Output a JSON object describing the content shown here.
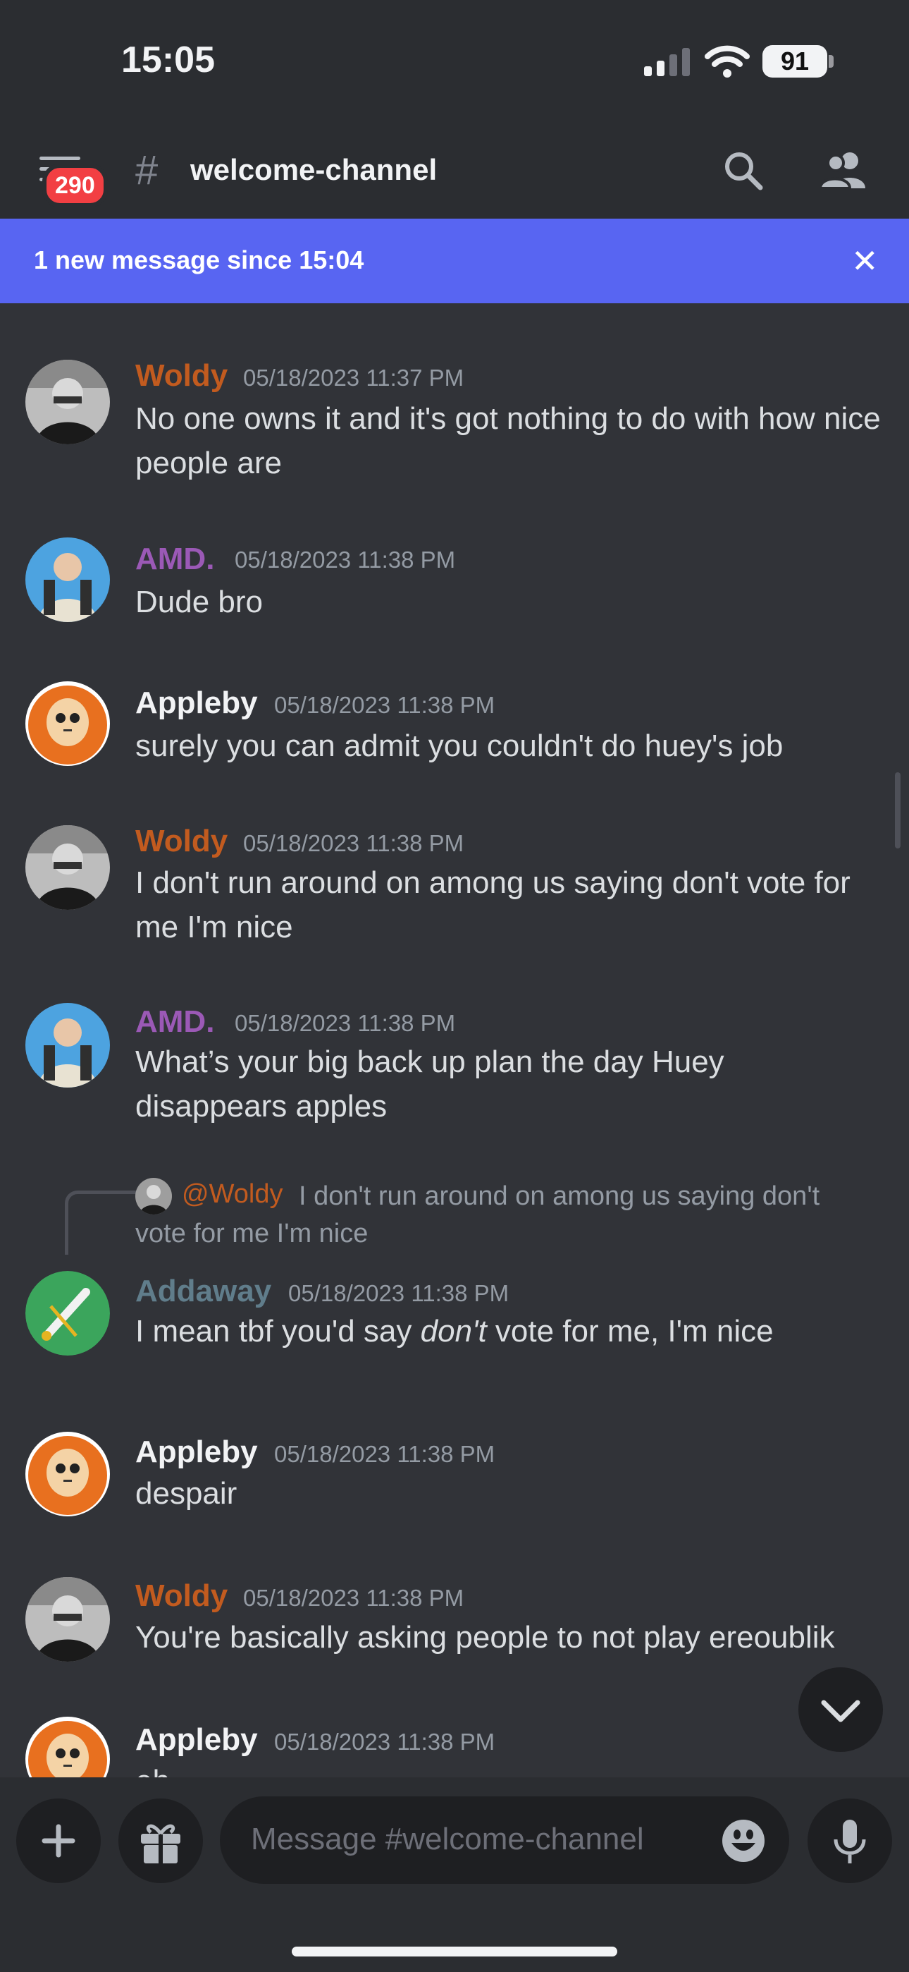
{
  "status_bar": {
    "time": "15:05",
    "battery": "91"
  },
  "header": {
    "unread_badge": "290",
    "hash": "#",
    "channel_name": "welcome-channel"
  },
  "new_message_bar": {
    "text": "1 new message since 15:04",
    "close": "✕"
  },
  "messages": [
    {
      "author": "Woldy",
      "timestamp": "05/18/2023 11:37 PM",
      "text": "No one owns it and it's got nothing to do with how nice people are"
    },
    {
      "author": "AMD.",
      "timestamp": "05/18/2023 11:38 PM",
      "text": "Dude bro"
    },
    {
      "author": "Appleby",
      "timestamp": "05/18/2023 11:38 PM",
      "text": "surely you can admit you couldn't do huey's job"
    },
    {
      "author": "Woldy",
      "timestamp": "05/18/2023 11:38 PM",
      "text": "I don't run around on among us saying don't vote for me I'm nice"
    },
    {
      "author": "AMD.",
      "timestamp": "05/18/2023 11:38 PM",
      "text": "What’s your big back up plan the day Huey disappears apples"
    },
    {
      "author": "Addaway",
      "timestamp": "05/18/2023 11:38 PM",
      "text_before": "I mean tbf you'd say ",
      "text_italic": "don't",
      "text_after": " vote for me, I'm nice",
      "reply": {
        "mention": "@Woldy",
        "text": "I don't run around on among us saying don't vote for me I'm nice"
      }
    },
    {
      "author": "Appleby",
      "timestamp": "05/18/2023 11:38 PM",
      "text": "despair"
    },
    {
      "author": "Woldy",
      "timestamp": "05/18/2023 11:38 PM",
      "text": "You're basically asking people to not play ereoublik"
    },
    {
      "author": "Appleby",
      "timestamp": "05/18/2023 11:38 PM",
      "text": "eh"
    }
  ],
  "composer": {
    "placeholder": "Message #welcome-channel"
  },
  "icons": [
    "hamburger-icon",
    "hash-icon",
    "search-icon",
    "members-icon",
    "close-icon",
    "chevron-down-icon",
    "plus-icon",
    "gift-icon",
    "emoji-icon",
    "microphone-icon"
  ],
  "colors": {
    "background": "#313338",
    "header": "#2b2d31",
    "accent": "#5865f2",
    "woldy": "#c25b1f",
    "amd": "#9b59b6",
    "addaway": "#607d8b",
    "badge": "#f23f43"
  }
}
